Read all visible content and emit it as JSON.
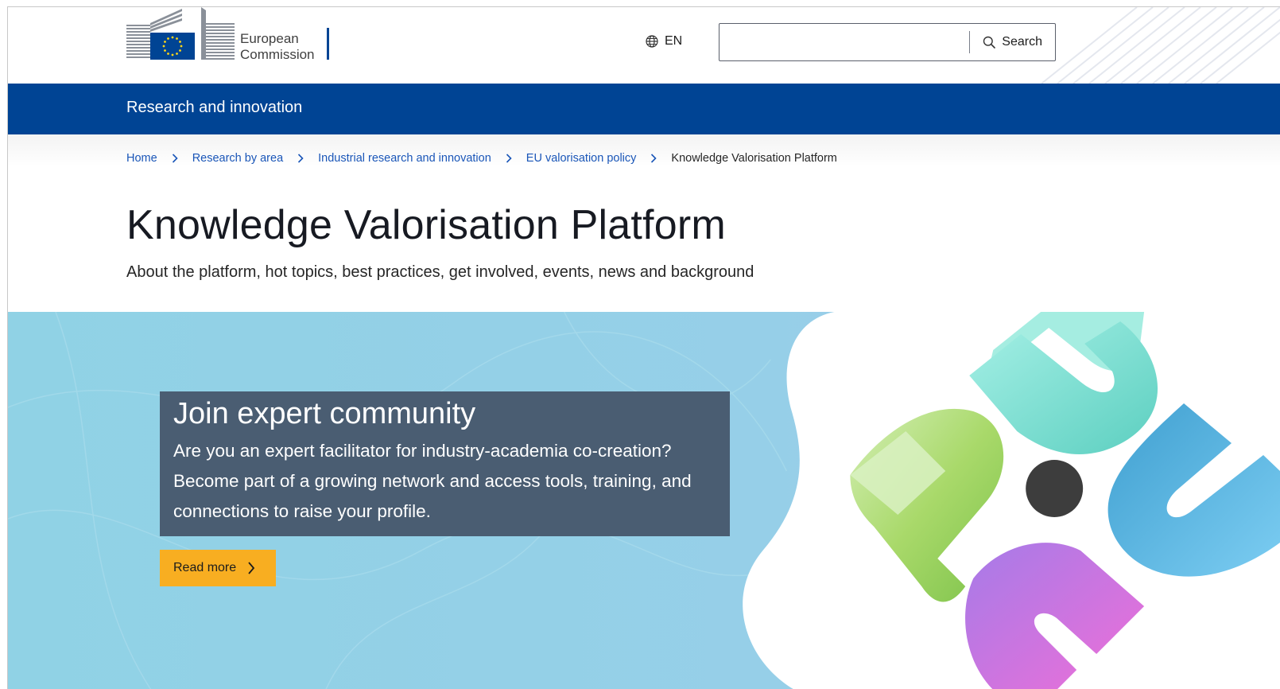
{
  "header": {
    "logo_line1": "European",
    "logo_line2": "Commission",
    "language": "EN",
    "search": {
      "value": "",
      "placeholder": "",
      "button_label": "Search"
    }
  },
  "site_bar": {
    "title": "Research and innovation"
  },
  "breadcrumb": {
    "items": [
      "Home",
      "Research by area",
      "Industrial research and innovation",
      "EU valorisation policy"
    ],
    "current": "Knowledge Valorisation Platform"
  },
  "page": {
    "title": "Knowledge Valorisation Platform",
    "subtitle": "About the platform, hot topics, best practices, get involved, events, news and background"
  },
  "banner": {
    "card_title": "Join expert community",
    "card_text": "Are you an expert facilitator for industry-academia co-creation? Become part of a growing network and access tools, training, and connections to raise your profile.",
    "button_label": "Read more"
  },
  "colors": {
    "brand_blue": "#004494",
    "link_blue": "#1a56b8",
    "banner_bg": "#93d1e6",
    "card_bg": "#4a5d72",
    "button_yellow": "#f8ae21"
  },
  "icons": {
    "language": "globe-icon",
    "search": "search-icon",
    "breadcrumb_separator": "chevron-right-icon",
    "read_more": "chevron-right-icon"
  }
}
